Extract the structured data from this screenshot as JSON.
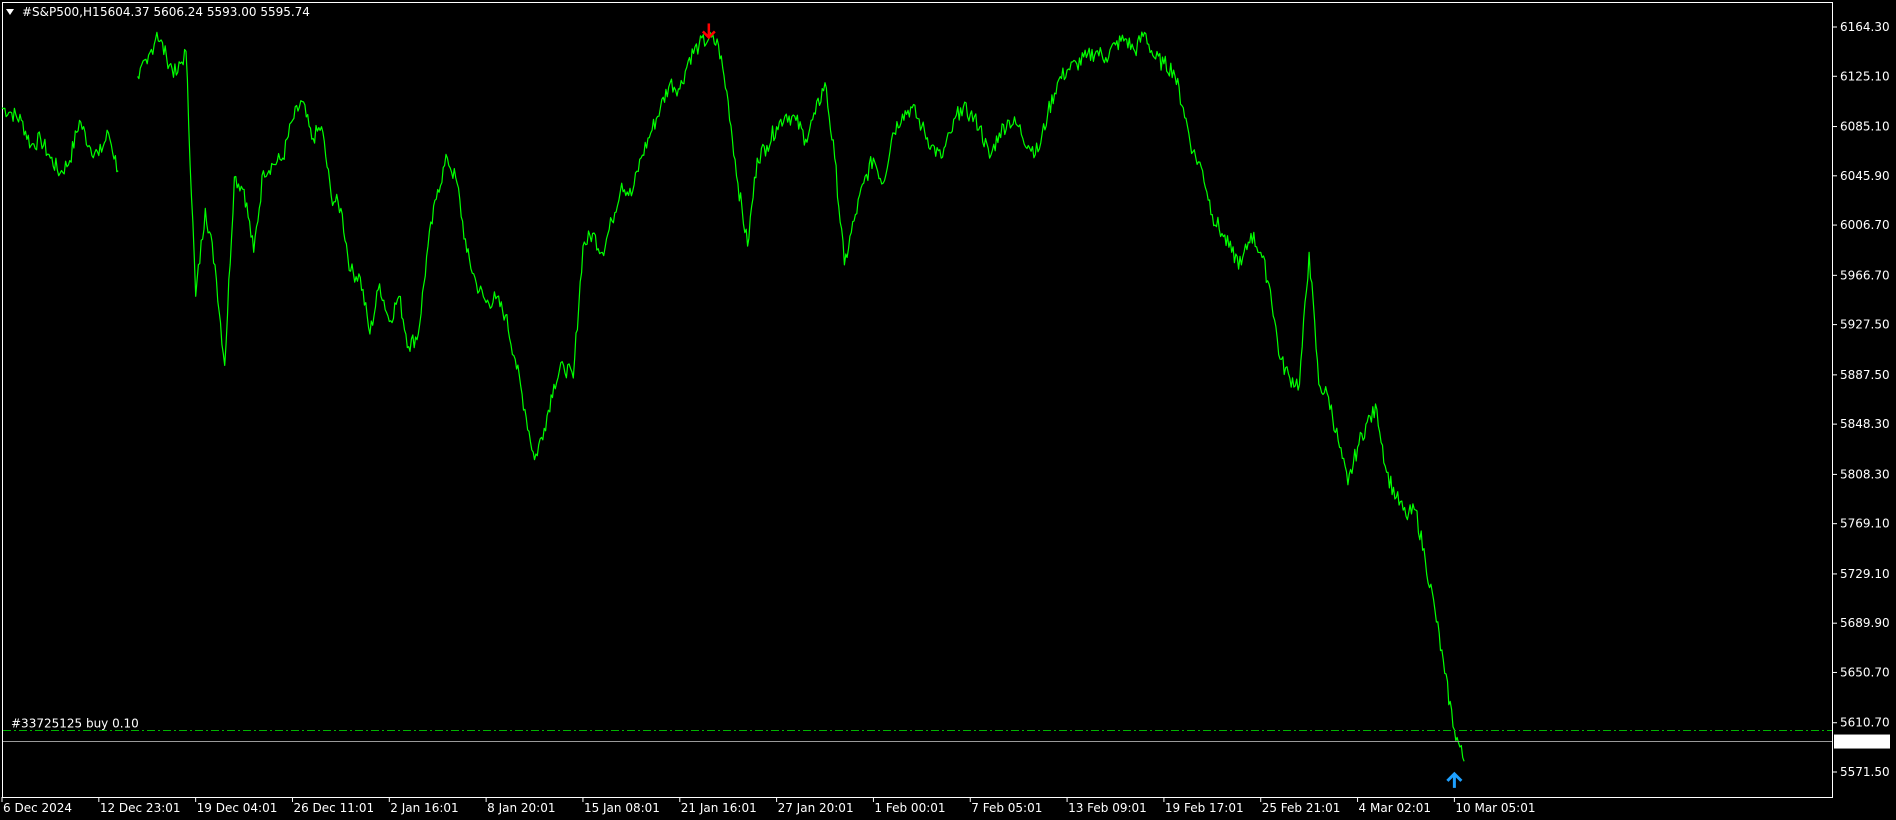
{
  "header": {
    "menu_icon": "triangle-down-icon",
    "symbol": "#S&P500,H1",
    "ohlc": "5604.37 5606.24 5593.00 5595.74"
  },
  "colors": {
    "background": "#000000",
    "frame": "#ffffff",
    "price_line": "#00ff00",
    "order_line": "#00b400",
    "bid_line": "#9a9a9a",
    "sell_arrow": "#ff0000",
    "buy_arrow": "#1ea0ff",
    "text": "#ffffff"
  },
  "chart_data": {
    "type": "line",
    "title": "#S&P500,H1",
    "xlabel": "",
    "ylabel": "",
    "ylim": [
      5551.6,
      6184.2
    ],
    "grid": false,
    "y_ticks": [
      6164.3,
      6125.1,
      6085.1,
      6045.9,
      6006.7,
      5966.7,
      5927.5,
      5887.5,
      5848.3,
      5808.3,
      5769.1,
      5729.1,
      5689.9,
      5650.7,
      5610.7,
      5571.5
    ],
    "x_tick_labels": [
      "6 Dec 2024",
      "12 Dec 23:01",
      "19 Dec 04:01",
      "26 Dec 11:01",
      "2 Jan 16:01",
      "8 Jan 20:01",
      "15 Jan 08:01",
      "21 Jan 16:01",
      "27 Jan 20:01",
      "1 Feb 00:01",
      "7 Feb 05:01",
      "13 Feb 09:01",
      "19 Feb 17:01",
      "25 Feb 21:01",
      "4 Mar 02:01",
      "10 Mar 05:01"
    ],
    "x_tick_index": [
      0,
      10,
      20,
      30,
      40,
      50,
      60,
      70,
      80,
      90,
      100,
      110,
      120,
      130,
      140,
      150
    ],
    "x_range": [
      0,
      189
    ],
    "series": [
      {
        "values": [
          6100,
          6096,
          6090,
          6070,
          6075,
          6060,
          6048,
          6058,
          6090,
          6070,
          6062,
          6080,
          6050,
          null,
          6125,
          6135,
          6160,
          6140,
          6126,
          6145,
          5950,
          6020,
          5975,
          5895,
          6045,
          6035,
          5985,
          6050,
          6055,
          6060,
          6090,
          6105,
          6075,
          6085,
          6030,
          6020,
          5970,
          5965,
          5920,
          5960,
          5930,
          5950,
          5910,
          5920,
          5990,
          6035,
          6060,
          6040,
          5985,
          5960,
          5945,
          5948,
          5935,
          5900,
          5860,
          5820,
          5845,
          5880,
          5895,
          5885,
          5990,
          6000,
          5985,
          6010,
          6040,
          6030,
          6060,
          6080,
          6100,
          6120,
          6115,
          6140,
          6150,
          6155,
          6150,
          6105,
          6040,
          5990,
          6060,
          6070,
          6085,
          6095,
          6090,
          6075,
          6095,
          6120,
          6060,
          5975,
          6010,
          6040,
          6060,
          6040,
          6080,
          6095,
          6100,
          6085,
          6070,
          6060,
          6080,
          6100,
          6095,
          6085,
          6060,
          6080,
          6090,
          6085,
          6070,
          6065,
          6095,
          6120,
          6130,
          6135,
          6140,
          6145,
          6140,
          6150,
          6155,
          6145,
          6160,
          6140,
          6135,
          6130,
          6100,
          6065,
          6050,
          6015,
          6000,
          5985,
          5975,
          6000,
          5985,
          5955,
          5900,
          5885,
          5880,
          5985,
          5880,
          5870,
          5835,
          5800,
          5830,
          5850,
          5860,
          5810,
          5790,
          5775,
          5780,
          5740,
          5700,
          5650,
          5605,
          5580
        ]
      }
    ],
    "annotations": [
      {
        "type": "order_line",
        "label": "#33725125 buy 0.10",
        "price": 5604.5
      },
      {
        "type": "bid_line",
        "label": "5595.74",
        "price": 5595.74
      },
      {
        "type": "sell_arrow",
        "x": 73,
        "price": 6156
      },
      {
        "type": "buy_arrow",
        "x": 150,
        "price": 5570
      }
    ]
  }
}
